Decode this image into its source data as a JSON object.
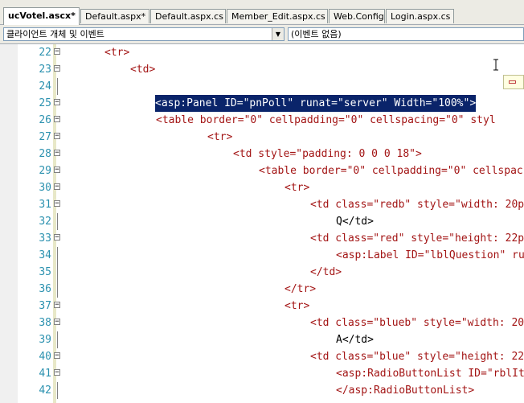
{
  "tabs": [
    {
      "label": "ucVotel.ascx*",
      "active": true
    },
    {
      "label": "Default.aspx*",
      "active": false
    },
    {
      "label": "Default.aspx.cs",
      "active": false
    },
    {
      "label": "Member_Edit.aspx.cs",
      "active": false
    },
    {
      "label": "Web.Config",
      "active": false
    },
    {
      "label": "Login.aspx.cs",
      "active": false
    }
  ],
  "toolbar": {
    "object_combo": "클라이언트 개체 및 이벤트",
    "event_combo": "(이벤트 없음)"
  },
  "lines": [
    {
      "num": "22",
      "code": "<tr>"
    },
    {
      "num": "23",
      "code": "<td>"
    },
    {
      "num": "24",
      "code": ""
    },
    {
      "num": "25",
      "code": "<asp:Panel ID=\"pnPoll\" runat=\"server\" Width=\"100%\">"
    },
    {
      "num": "26",
      "code": "<table border=\"0\" cellpadding=\"0\" cellspacing=\"0\" styl"
    },
    {
      "num": "27",
      "code": "<tr>"
    },
    {
      "num": "28",
      "code": "<td style=\"padding: 0 0 0 18\">"
    },
    {
      "num": "29",
      "code": "<table border=\"0\" cellpadding=\"0\" cellspac"
    },
    {
      "num": "30",
      "code": "<tr>"
    },
    {
      "num": "31",
      "code": "<td class=\"redb\" style=\"width: 20p"
    },
    {
      "num": "32",
      "code": "Q</td>"
    },
    {
      "num": "33",
      "code": "<td class=\"red\" style=\"height: 22p"
    },
    {
      "num": "34",
      "code": "<asp:Label ID=\"lblQuestion\" ru"
    },
    {
      "num": "35",
      "code": "</td>"
    },
    {
      "num": "36",
      "code": "</tr>"
    },
    {
      "num": "37",
      "code": "<tr>"
    },
    {
      "num": "38",
      "code": "<td class=\"blueb\" style=\"width: 20"
    },
    {
      "num": "39",
      "code": "A</td>"
    },
    {
      "num": "40",
      "code": "<td class=\"blue\" style=\"height: 22"
    },
    {
      "num": "41",
      "code": "<asp:RadioButtonList ID=\"rblIt"
    },
    {
      "num": "42",
      "code": "</asp:RadioButtonList>"
    }
  ]
}
